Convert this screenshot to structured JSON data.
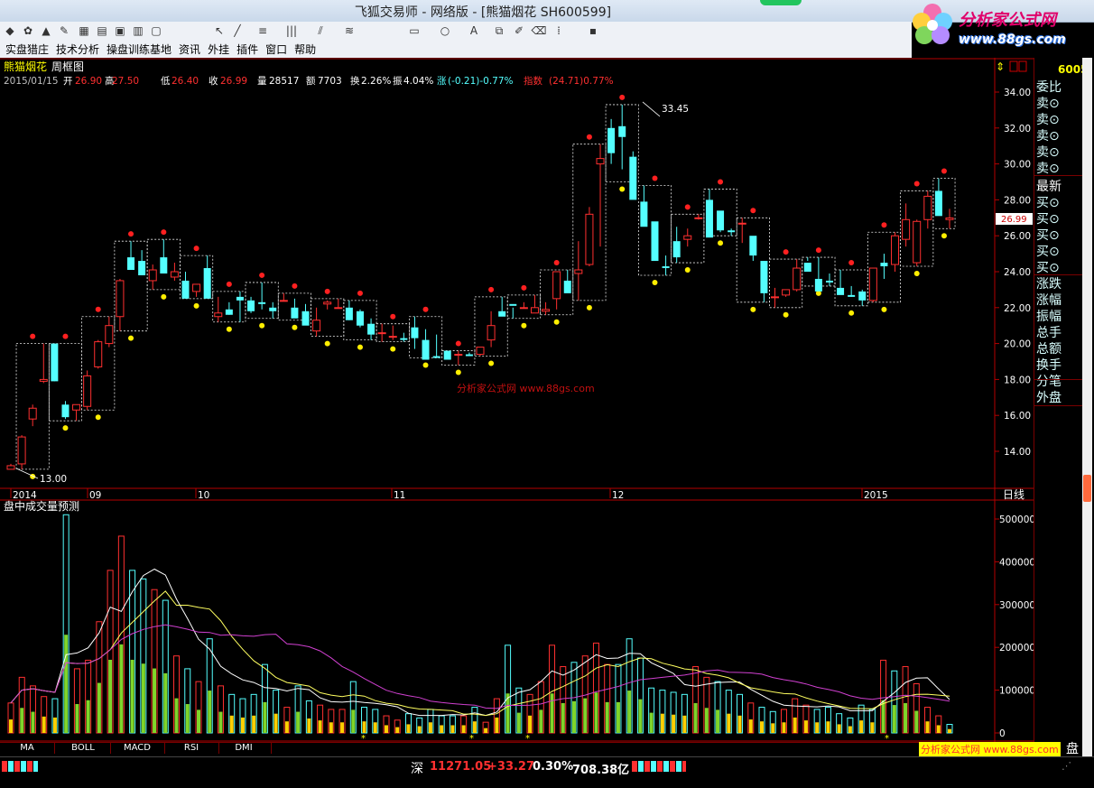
{
  "window": {
    "title": "飞狐交易师 - 网络版 - [熊猫烟花 SH600599]"
  },
  "logo": {
    "line1": "分析家公式网",
    "line2": "www.88gs.com"
  },
  "menu": [
    "实盘猎庄",
    "技术分析",
    "操盘训练基地",
    "资讯",
    "外挂",
    "插件",
    "窗口",
    "帮助"
  ],
  "toolbar_icons": [
    "app-icon",
    "alarm-icon",
    "bell-icon",
    "pen-icon",
    "kline-icon",
    "table-icon",
    "chart-icon",
    "view-icon",
    "window-icon",
    "cursor-icon",
    "line-tool-icon",
    "text-tool-icon",
    "bar-tool-icon",
    "fan-tool-icon",
    "pattern-icon",
    "rect-tool-icon",
    "circle-tool-icon",
    "font-icon",
    "copy-icon",
    "highlight-icon",
    "erase-icon",
    "color-icon",
    "save-icon"
  ],
  "header": {
    "stock_name": "熊猫烟花",
    "period": "周框图",
    "date": "2015/01/15",
    "open_label": "开",
    "open": "26.90",
    "high_label": "高",
    "high": "27.50",
    "low_label": "低",
    "low": "26.40",
    "close_label": "收",
    "close": "26.99",
    "vol_label": "量",
    "vol": "28517",
    "amount_label": "额",
    "amount": "7703",
    "turnover_label": "换",
    "turnover": "2.26%",
    "amplitude_label": "振",
    "amplitude": "4.04%",
    "change_label": "涨",
    "change": "(-0.21)-0.77%",
    "index_label": "指数",
    "index": "(24.71)0.77%"
  },
  "price_axis": [
    "34.00",
    "32.00",
    "30.00",
    "28.00",
    "26.00",
    "24.00",
    "22.00",
    "20.00",
    "18.00",
    "16.00",
    "14.00"
  ],
  "current_price_tag": "26.99",
  "annotations": {
    "max_label": "33.45",
    "min_label": "13.00"
  },
  "center_watermark": "分析家公式网 www.88gs.com",
  "time_axis": [
    "2014",
    "09",
    "10",
    "11",
    "12",
    "2015"
  ],
  "period_label": "日线",
  "volume_title": "盘中成交量预测",
  "volume_axis": [
    "500000",
    "400000",
    "300000",
    "200000",
    "100000",
    "0"
  ],
  "right_panel": {
    "code": "6005",
    "items": [
      "委比",
      "卖⊙",
      "卖⊙",
      "卖⊙",
      "卖⊙",
      "卖⊙",
      "最新",
      "买⊙",
      "买⊙",
      "买⊙",
      "买⊙",
      "买⊙",
      "涨跌",
      "涨幅",
      "振幅",
      "总手",
      "总额",
      "换手",
      "分笔",
      "外盘"
    ],
    "bottom": "盘"
  },
  "bottom_tabs": [
    "MA",
    "BOLL",
    "MACD",
    "RSI",
    "DMI"
  ],
  "bottom_watermark": "分析家公式网 www.88gs.com",
  "status": {
    "market": "深",
    "index": "11271.05",
    "change": "+33.27",
    "pct": "0.30%",
    "amount": "708.38亿"
  },
  "colors": {
    "up": "#ff3030",
    "down": "#54ffff",
    "background": "#000000",
    "axis": "#b40000"
  },
  "chart_data": {
    "type": "candlestick",
    "title": "熊猫烟花 周框图",
    "ylim": [
      12.5,
      34.8
    ],
    "candles_ohlc": [
      [
        13.0,
        13.3,
        13.0,
        13.2
      ],
      [
        13.3,
        14.9,
        13.0,
        14.8
      ],
      [
        15.8,
        16.6,
        15.4,
        16.4
      ],
      [
        17.9,
        20.0,
        17.8,
        18.0
      ],
      [
        20.0,
        20.0,
        17.9,
        17.9
      ],
      [
        16.6,
        16.8,
        15.8,
        15.9
      ],
      [
        16.3,
        16.5,
        15.7,
        16.6
      ],
      [
        16.5,
        18.5,
        16.3,
        18.2
      ],
      [
        18.7,
        20.2,
        18.6,
        20.1
      ],
      [
        20.0,
        21.5,
        19.8,
        21.0
      ],
      [
        21.5,
        23.6,
        20.7,
        23.5
      ],
      [
        24.8,
        25.7,
        24.4,
        24.1
      ],
      [
        24.6,
        25.2,
        23.8,
        23.8
      ],
      [
        23.5,
        24.4,
        23.0,
        24.1
      ],
      [
        24.8,
        25.8,
        24.1,
        23.9
      ],
      [
        23.7,
        24.5,
        23.5,
        24.0
      ],
      [
        23.5,
        24.0,
        22.5,
        22.5
      ],
      [
        22.9,
        23.3,
        22.6,
        23.3
      ],
      [
        24.2,
        24.9,
        23.1,
        22.5
      ],
      [
        21.5,
        22.6,
        21.2,
        21.7
      ],
      [
        21.9,
        22.3,
        21.6,
        21.6
      ],
      [
        22.6,
        22.9,
        21.2,
        22.4
      ],
      [
        22.4,
        22.6,
        21.7,
        21.8
      ],
      [
        22.3,
        23.4,
        21.9,
        22.2
      ],
      [
        22.0,
        22.3,
        21.4,
        21.8
      ],
      [
        22.4,
        22.8,
        22.4,
        22.4
      ],
      [
        22.0,
        22.5,
        21.5,
        21.4
      ],
      [
        21.8,
        22.2,
        21.3,
        21.0
      ],
      [
        20.7,
        22.0,
        20.4,
        21.3
      ],
      [
        22.2,
        22.4,
        21.9,
        22.3
      ],
      [
        22.0,
        22.5,
        22.0,
        22.0
      ],
      [
        22.0,
        22.4,
        21.3,
        21.3
      ],
      [
        21.8,
        21.9,
        20.9,
        21.0
      ],
      [
        21.1,
        21.4,
        20.2,
        20.5
      ],
      [
        20.6,
        21.1,
        20.1,
        20.6
      ],
      [
        20.4,
        21.0,
        20.2,
        20.4
      ],
      [
        20.3,
        20.6,
        20.1,
        20.2
      ],
      [
        20.9,
        21.5,
        19.7,
        20.3
      ],
      [
        20.2,
        20.8,
        19.5,
        19.1
      ],
      [
        19.3,
        20.5,
        19.2,
        19.2
      ],
      [
        19.6,
        19.5,
        19.3,
        19.1
      ],
      [
        19.4,
        19.6,
        18.8,
        19.4
      ],
      [
        19.4,
        19.5,
        19.3,
        19.3
      ],
      [
        19.4,
        19.8,
        19.3,
        19.8
      ],
      [
        20.2,
        21.8,
        19.8,
        21.0
      ],
      [
        21.8,
        22.6,
        21.6,
        21.5
      ],
      [
        22.2,
        22.0,
        21.4,
        22.1
      ],
      [
        22.0,
        22.3,
        22.0,
        22.0
      ],
      [
        21.7,
        22.7,
        21.8,
        22.0
      ],
      [
        21.8,
        22.3,
        21.6,
        21.9
      ],
      [
        22.5,
        23.9,
        21.9,
        24.0
      ],
      [
        23.5,
        24.1,
        23.2,
        22.8
      ],
      [
        23.9,
        25.7,
        22.4,
        24.1
      ],
      [
        24.4,
        27.6,
        24.3,
        27.2
      ],
      [
        30.0,
        31.1,
        25.4,
        30.3
      ],
      [
        32.0,
        32.5,
        30.0,
        30.6
      ],
      [
        32.1,
        33.3,
        29.7,
        31.5
      ],
      [
        30.4,
        30.7,
        29.0,
        28.0
      ],
      [
        27.9,
        28.8,
        27.2,
        26.5
      ],
      [
        26.8,
        26.7,
        25.0,
        24.6
      ],
      [
        24.3,
        24.9,
        23.8,
        24.2
      ],
      [
        25.7,
        26.5,
        24.5,
        24.8
      ],
      [
        25.8,
        26.4,
        25.4,
        26.0
      ],
      [
        27.0,
        27.2,
        26.9,
        27.0
      ],
      [
        28.0,
        28.6,
        27.6,
        25.9
      ],
      [
        27.4,
        27.1,
        26.2,
        26.3
      ],
      [
        26.3,
        26.4,
        26.0,
        26.2
      ],
      [
        26.7,
        27.0,
        25.6,
        26.7
      ],
      [
        26.0,
        25.8,
        24.6,
        24.9
      ],
      [
        24.6,
        24.6,
        22.3,
        22.8
      ],
      [
        22.6,
        23.1,
        22.0,
        22.6
      ],
      [
        22.7,
        22.9,
        22.6,
        23.0
      ],
      [
        23.0,
        24.7,
        22.9,
        24.2
      ],
      [
        24.5,
        24.8,
        24.6,
        24.0
      ],
      [
        23.6,
        24.8,
        23.6,
        22.9
      ],
      [
        23.5,
        23.9,
        23.2,
        23.4
      ],
      [
        23.1,
        24.1,
        22.8,
        22.7
      ],
      [
        22.7,
        23.2,
        22.6,
        22.6
      ],
      [
        22.9,
        23.0,
        22.1,
        22.4
      ],
      [
        22.4,
        24.2,
        22.3,
        24.2
      ],
      [
        24.5,
        25.0,
        23.6,
        24.3
      ],
      [
        24.4,
        26.2,
        24.0,
        26.0
      ],
      [
        25.8,
        27.8,
        25.4,
        26.9
      ],
      [
        24.5,
        26.9,
        24.3,
        26.8
      ],
      [
        26.9,
        28.5,
        26.4,
        28.2
      ],
      [
        28.5,
        29.2,
        28.2,
        27.1
      ],
      [
        26.9,
        27.5,
        26.4,
        26.99
      ]
    ],
    "volume": [
      70000,
      130000,
      110000,
      85000,
      80000,
      510000,
      150000,
      170000,
      260000,
      380000,
      460000,
      380000,
      360000,
      335000,
      310000,
      180000,
      150000,
      120000,
      220000,
      110000,
      90000,
      80000,
      90000,
      160000,
      100000,
      60000,
      110000,
      75000,
      65000,
      55000,
      55000,
      120000,
      60000,
      55000,
      40000,
      30000,
      45000,
      35000,
      55000,
      40000,
      40000,
      40000,
      60000,
      25000,
      80000,
      205000,
      105000,
      90000,
      120000,
      205000,
      155000,
      165000,
      180000,
      210000,
      160000,
      160000,
      220000,
      175000,
      105000,
      100000,
      95000,
      90000,
      155000,
      130000,
      120000,
      100000,
      90000,
      70000,
      60000,
      50000,
      55000,
      80000,
      65000,
      55000,
      60000,
      45000,
      35000,
      65000,
      55000,
      170000,
      145000,
      155000,
      115000,
      60000,
      40000,
      20000
    ]
  }
}
